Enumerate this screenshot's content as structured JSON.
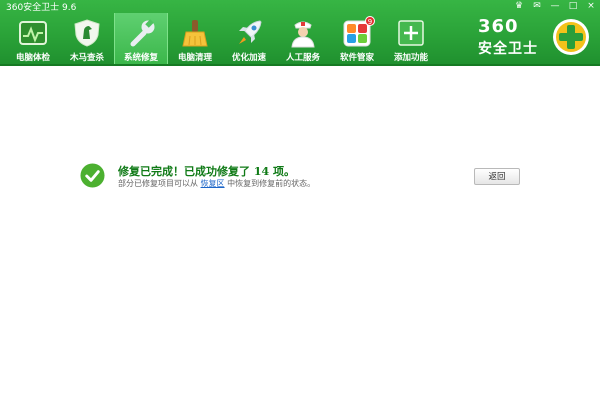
{
  "app": {
    "title": "360安全卫士 9.6"
  },
  "nav": {
    "items": [
      {
        "label": "电脑体检",
        "icon": "checkup-icon"
      },
      {
        "label": "木马查杀",
        "icon": "horse-shield-icon"
      },
      {
        "label": "系统修复",
        "icon": "wrench-icon",
        "active": true
      },
      {
        "label": "电脑清理",
        "icon": "broom-icon"
      },
      {
        "label": "优化加速",
        "icon": "rocket-icon"
      },
      {
        "label": "人工服务",
        "icon": "doctor-icon"
      },
      {
        "label": "软件管家",
        "icon": "software-grid-icon",
        "badge": "9"
      },
      {
        "label": "添加功能",
        "icon": "plus-box-icon"
      }
    ]
  },
  "window_controls": [
    "♛",
    "✉",
    "—",
    "□",
    "×"
  ],
  "brand": {
    "number": "360",
    "text": "安全卫士"
  },
  "result": {
    "title": "修复已完成！已成功修复了 14 项。",
    "sub_prefix": "部分已修复项目可以从",
    "sub_link": "恢复区",
    "sub_suffix": "中恢复到修复前的状态。",
    "back_label": "返回"
  },
  "colors": {
    "header_green": "#2aa238",
    "accent_green": "#0f7a16",
    "link_blue": "#1d66c8"
  }
}
